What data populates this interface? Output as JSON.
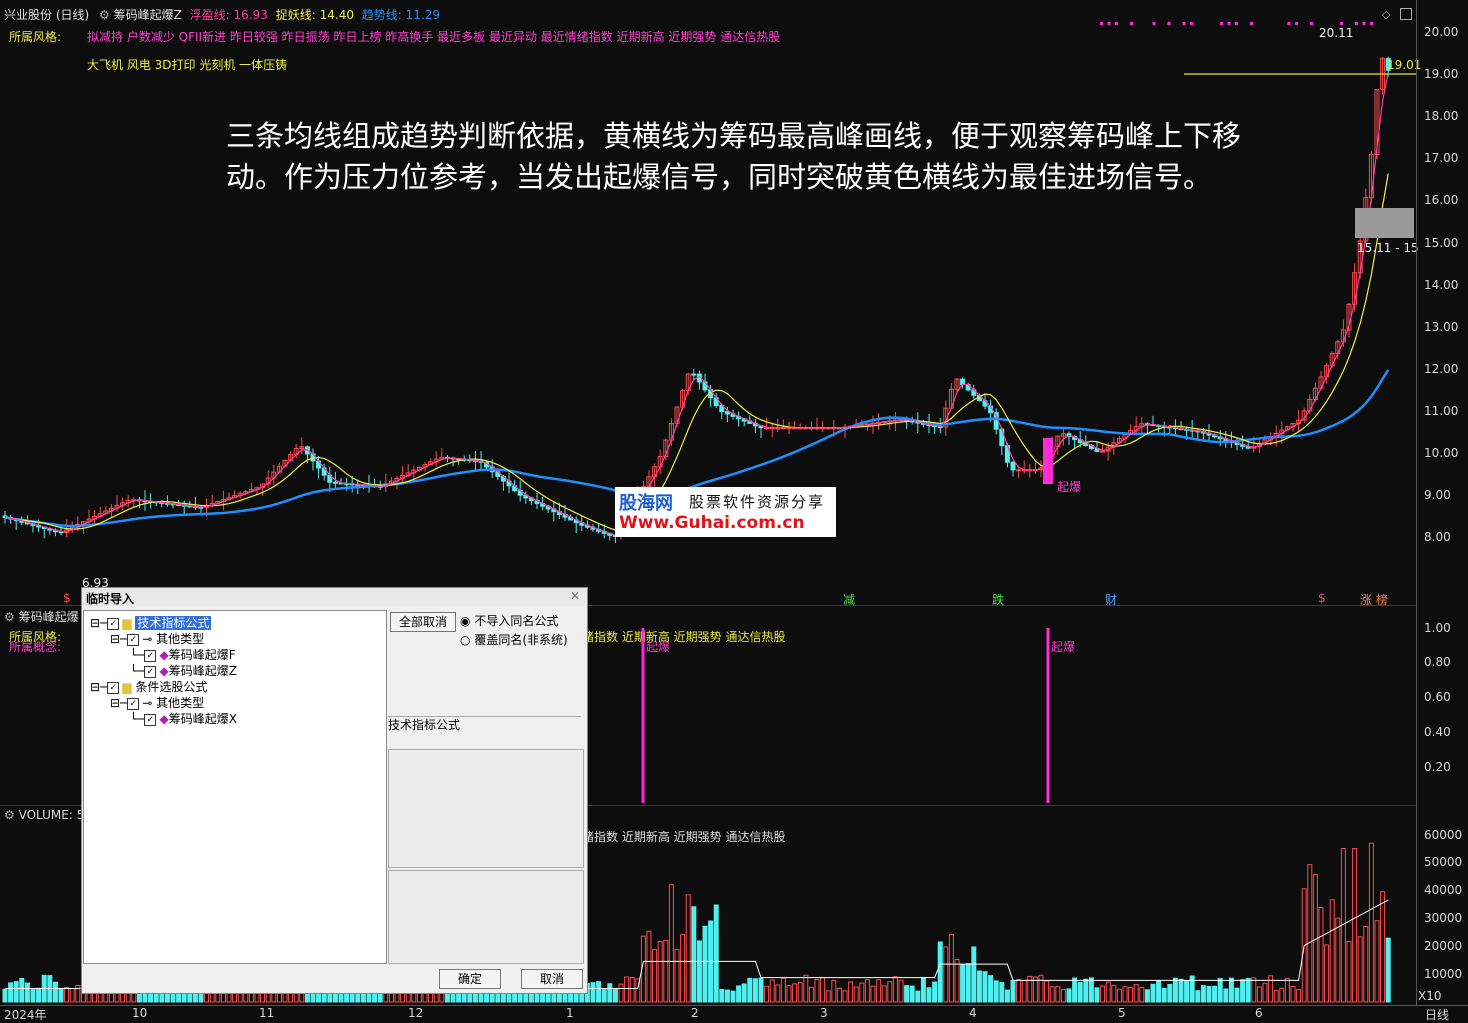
{
  "header": {
    "stock": "兴业股份 (日线)",
    "indicator": "筹码峰起爆Z",
    "fuying_label": "浮盈线:",
    "fuying_value": "16.93",
    "zhuoyao_label": "捉妖线:",
    "zhuoyao_value": "14.40",
    "qushi_label": "趋势线:",
    "qushi_value": "11.29",
    "style_label": "所属风格:",
    "style_items": "拟减持 户数减少 QFII新进 昨日较强 昨日振荡 昨日上榜 昨高换手 最近多板 最近异动 最近情绪指数 近期新高 近期强势 通达信热股",
    "concept_items": "大飞机 风电 3D打印 光刻机 一体压铸"
  },
  "annotation": "三条均线组成趋势判断依据，黄横线为筹码最高峰画线，便于观察筹码峰上下移动。作为压力位参考，当发出起爆信号，同时突破黄色横线为最佳进场信号。",
  "watermark": {
    "cn": "股海网",
    "sub": "股票软件资源分享",
    "url": "Www.Guhai.com.cn"
  },
  "price_axis": [
    "20.00",
    "19.00",
    "18.00",
    "17.00",
    "16.00",
    "15.00",
    "14.00",
    "13.00",
    "12.00",
    "11.00",
    "10.00",
    "9.00",
    "8.00"
  ],
  "price_labels": {
    "high": "20.11",
    "line": "19.01",
    "range": "15.11 - 15",
    "low": "6.93"
  },
  "markers": {
    "jian": "减",
    "die": "跌",
    "cai": "财",
    "dollar": "$",
    "zhangbang": "涨 榜",
    "qibao": "起爆"
  },
  "pane2": {
    "title": "筹码峰起爆",
    "style_label": "所属风格:",
    "concept_label": "所属概念:",
    "tail_text": "绪指数 近期新高 近期强势 通达信热股",
    "axis": [
      "1.00",
      "0.80",
      "0.60",
      "0.40",
      "0.20"
    ],
    "signal": "起爆"
  },
  "pane3": {
    "title": "VOLUME: 5",
    "tail_text": "绪指数 近期新高 近期强势 通达信热股",
    "axis": [
      "60000",
      "50000",
      "40000",
      "30000",
      "20000",
      "10000"
    ],
    "unit": "X10"
  },
  "date_axis": {
    "year": "2024年",
    "months": [
      "10",
      "11",
      "12",
      "1",
      "2",
      "3",
      "4",
      "5",
      "6"
    ],
    "period": "日线"
  },
  "dialog": {
    "title": "临时导入",
    "tree": {
      "root1": "技术指标公式",
      "group1": "其他类型",
      "leaf1": "筹码峰起爆F",
      "leaf2": "筹码峰起爆Z",
      "root2": "条件选股公式",
      "group2": "其他类型",
      "leaf3": "筹码峰起爆X"
    },
    "cancel_all": "全部取消",
    "radio1": "不导入同名公式",
    "radio2": "覆盖同名(非系统)",
    "section": "技术指标公式",
    "ok": "确定",
    "cancel": "取消"
  },
  "colors": {
    "up": "#ff4a4a",
    "down": "#4ff0f0",
    "ma_white": "#ffffff",
    "ma_yellow": "#f5f53c",
    "ma_pink": "#ff3fa0",
    "ma_blue": "#1e8fff",
    "signal": "#ff2cd6"
  }
}
